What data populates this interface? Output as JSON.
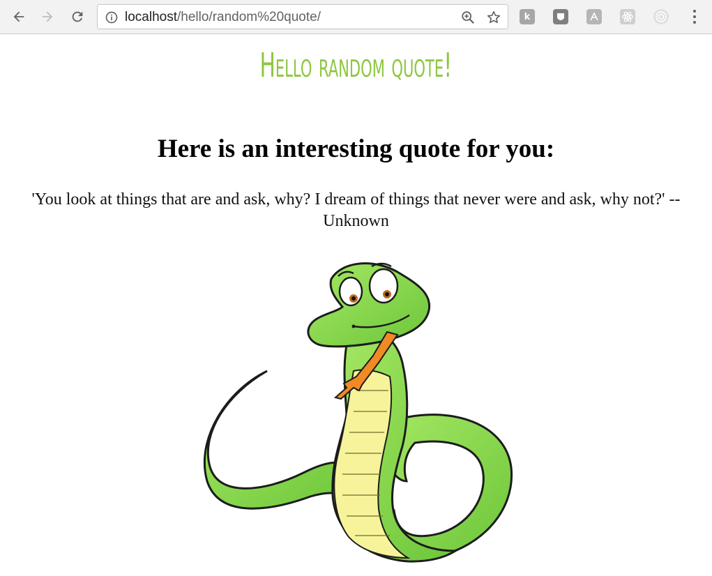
{
  "browser": {
    "url_host": "localhost",
    "url_path": "/hello/random%20quote/",
    "icons": {
      "back": "arrow-left-icon",
      "forward": "arrow-right-icon",
      "reload": "reload-icon",
      "info": "info-icon",
      "zoom": "zoom-in-icon",
      "bookmark": "star-icon",
      "menu": "more-vert-icon"
    },
    "extensions": [
      {
        "name": "k-extension-icon",
        "glyph": "k",
        "color": "#9e9e9e"
      },
      {
        "name": "shield-extension-icon",
        "glyph": "",
        "color": "#8a8a8a"
      },
      {
        "name": "acrobat-extension-icon",
        "glyph": "",
        "color": "#b0b0b0"
      },
      {
        "name": "react-extension-icon",
        "glyph": "",
        "color": "#c8c8c8"
      },
      {
        "name": "target-extension-icon",
        "glyph": "",
        "color": "#d0d0d0"
      }
    ]
  },
  "page": {
    "title": "Hello random quote!",
    "heading": "Here is an interesting quote for you:",
    "quote": "'You look at things that are and ask, why? I dream of things that never were and ask, why not?' -- Unknown",
    "title_color": "#8cc63f",
    "image": "cartoon-snake-image"
  }
}
